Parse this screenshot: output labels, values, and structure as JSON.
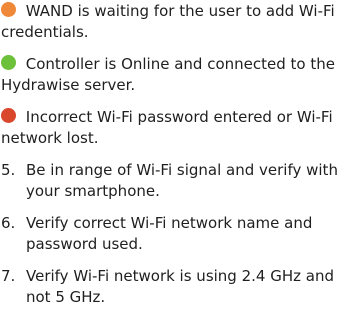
{
  "status_items": [
    {
      "color": "#f0883a",
      "text": " WAND is waiting for the user to add Wi-Fi credentials."
    },
    {
      "color": "#6cc03a",
      "text": " Controller is Online and connected to the Hydrawise server."
    },
    {
      "color": "#d9472c",
      "text": " Incorrect Wi-Fi password entered or Wi-Fi network lost."
    }
  ],
  "steps": [
    {
      "num": "5.",
      "text": "Be in range of Wi-Fi signal and verify with your smartphone."
    },
    {
      "num": "6.",
      "text": "Verify correct Wi-Fi network name and password used."
    },
    {
      "num": "7.",
      "text": "Verify Wi-Fi network is using 2.4 GHz and not 5 GHz."
    }
  ]
}
